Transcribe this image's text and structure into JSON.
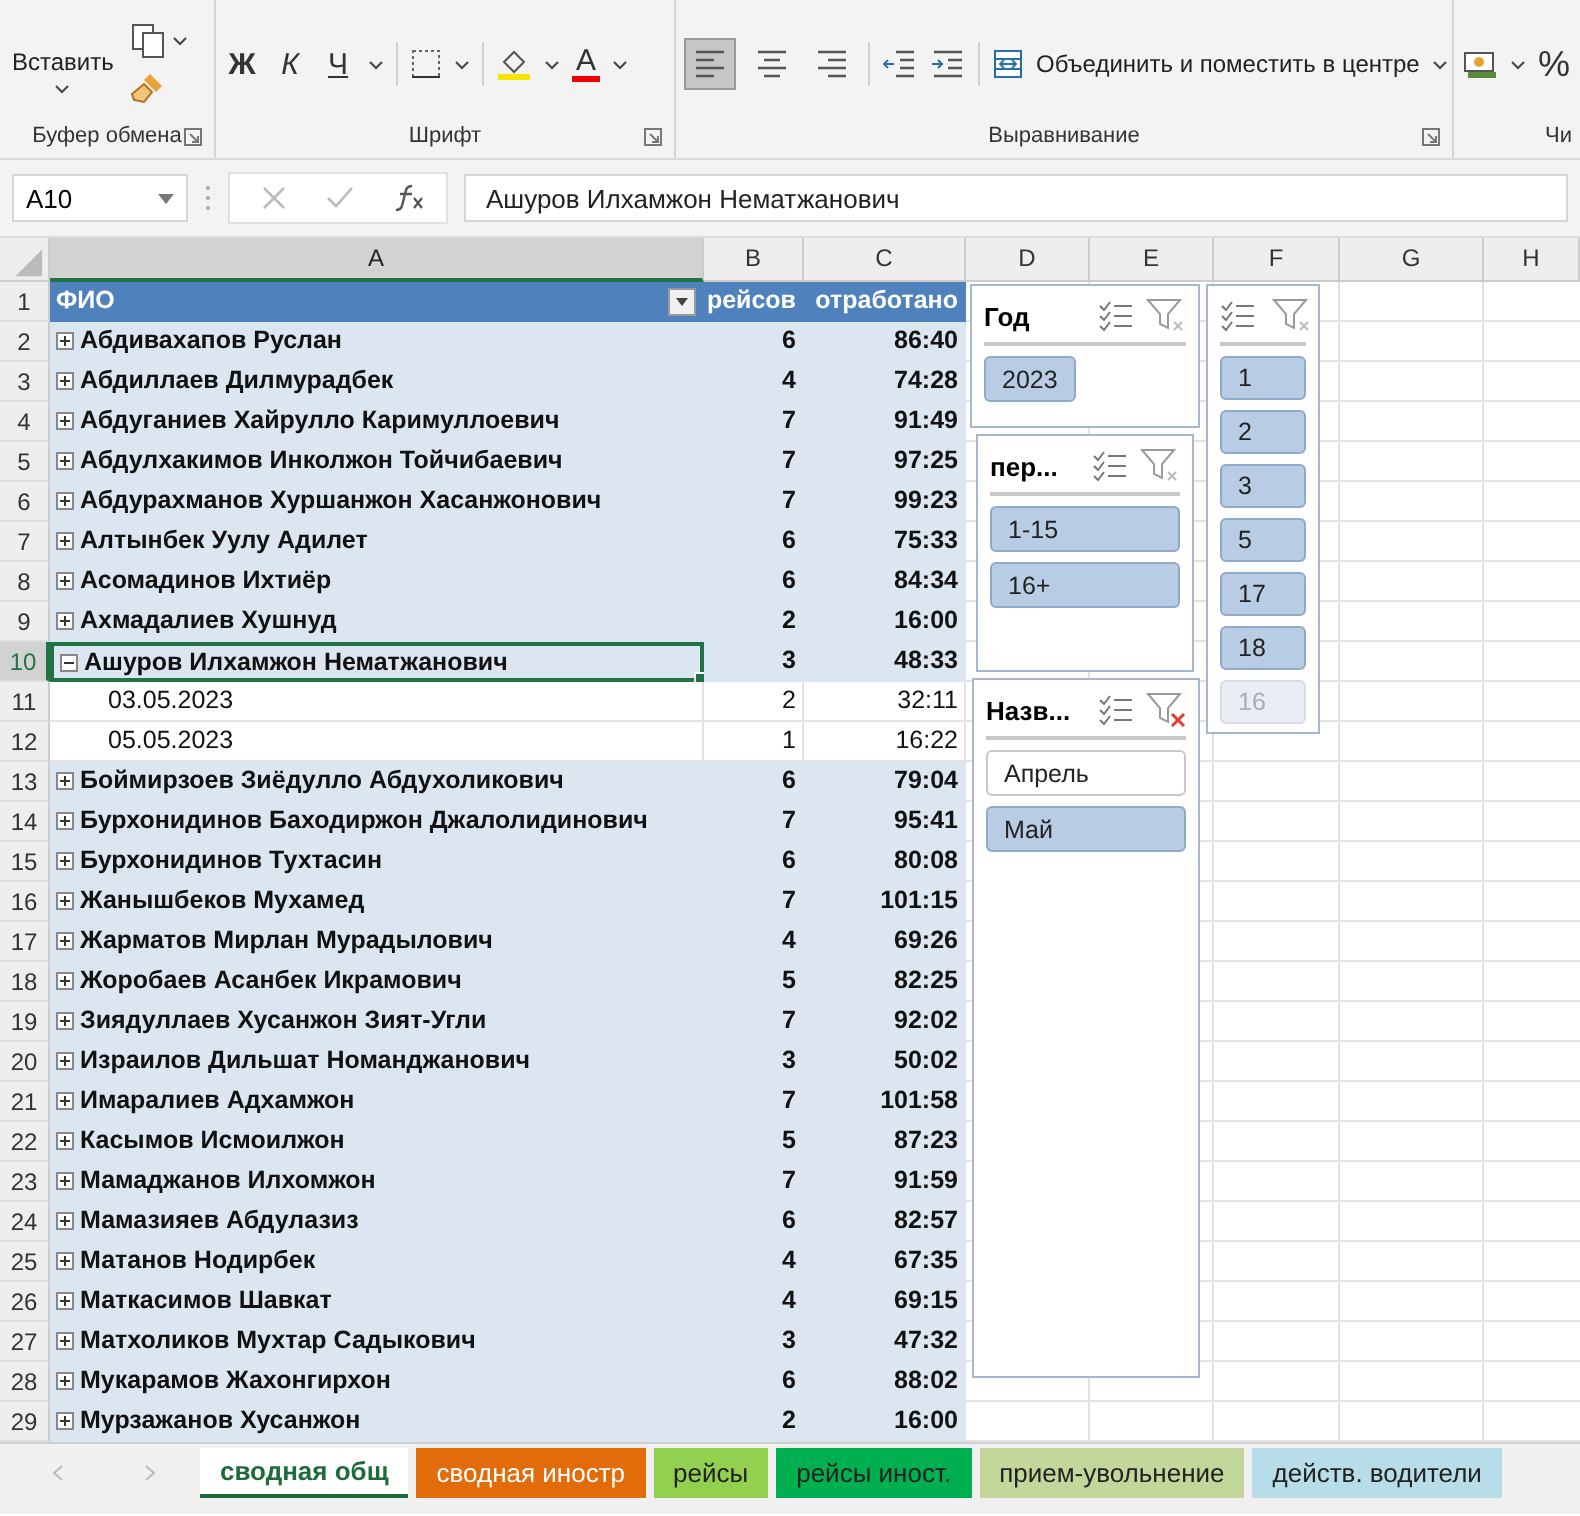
{
  "ribbon": {
    "paste_label": "Вставить",
    "font_buttons": [
      "Ж",
      "К",
      "Ч"
    ],
    "font_color_glyph": "A",
    "align_buttons": [
      {
        "selected": true
      },
      {
        "selected": false
      },
      {
        "selected": false
      }
    ],
    "merge_label": "Объединить и поместить в центре",
    "percent": "%",
    "groups": [
      {
        "label": "Буфер обмена"
      },
      {
        "label": "Шрифт"
      },
      {
        "label": "Выравнивание"
      },
      {
        "label": "Чи"
      }
    ]
  },
  "name_box": "A10",
  "formula": "Ашуров Илхамжон Нематжанович",
  "columns": [
    {
      "label": "A",
      "selected": true
    },
    {
      "label": "B",
      "selected": false
    },
    {
      "label": "C",
      "selected": false
    },
    {
      "label": "D",
      "selected": false
    },
    {
      "label": "E",
      "selected": false
    },
    {
      "label": "F",
      "selected": false
    },
    {
      "label": "G",
      "selected": false
    },
    {
      "label": "H",
      "selected": false
    }
  ],
  "table": {
    "header_row": "1",
    "headers": [
      "ФИО",
      "рейсов",
      "отработано"
    ],
    "rows": [
      {
        "row": "2",
        "kind": "group",
        "expanded": false,
        "selected": false,
        "name": "Абдивахапов Руслан",
        "trips": "6",
        "hours": "86:40"
      },
      {
        "row": "3",
        "kind": "group",
        "expanded": false,
        "selected": false,
        "name": "Абдиллаев Дилмурадбек",
        "trips": "4",
        "hours": "74:28"
      },
      {
        "row": "4",
        "kind": "group",
        "expanded": false,
        "selected": false,
        "name": "Абдуганиев Хайрулло Каримуллоевич",
        "trips": "7",
        "hours": "91:49"
      },
      {
        "row": "5",
        "kind": "group",
        "expanded": false,
        "selected": false,
        "name": "Абдулхакимов Инколжон Тойчибаевич",
        "trips": "7",
        "hours": "97:25"
      },
      {
        "row": "6",
        "kind": "group",
        "expanded": false,
        "selected": false,
        "name": "Абдурахманов Хуршанжон Хасанжонович",
        "trips": "7",
        "hours": "99:23"
      },
      {
        "row": "7",
        "kind": "group",
        "expanded": false,
        "selected": false,
        "name": "Алтынбек Уулу Адилет",
        "trips": "6",
        "hours": "75:33"
      },
      {
        "row": "8",
        "kind": "group",
        "expanded": false,
        "selected": false,
        "name": "Асомадинов Ихтиёр",
        "trips": "6",
        "hours": "84:34"
      },
      {
        "row": "9",
        "kind": "group",
        "expanded": false,
        "selected": false,
        "name": "Ахмадалиев Хушнуд",
        "trips": "2",
        "hours": "16:00"
      },
      {
        "row": "10",
        "kind": "group",
        "expanded": true,
        "selected": true,
        "name": "Ашуров Илхамжон Нематжанович",
        "trips": "3",
        "hours": "48:33"
      },
      {
        "row": "11",
        "kind": "detail",
        "selected": false,
        "name": "03.05.2023",
        "trips": "2",
        "hours": "32:11"
      },
      {
        "row": "12",
        "kind": "detail",
        "selected": false,
        "name": "05.05.2023",
        "trips": "1",
        "hours": "16:22"
      },
      {
        "row": "13",
        "kind": "group",
        "expanded": false,
        "selected": false,
        "name": "Боймирзоев Зиёдулло Абдухоликович",
        "trips": "6",
        "hours": "79:04"
      },
      {
        "row": "14",
        "kind": "group",
        "expanded": false,
        "selected": false,
        "name": "Бурхонидинов Баходиржон Джалолидинович",
        "trips": "7",
        "hours": "95:41"
      },
      {
        "row": "15",
        "kind": "group",
        "expanded": false,
        "selected": false,
        "name": "Бурхонидинов Тухтасин",
        "trips": "6",
        "hours": "80:08"
      },
      {
        "row": "16",
        "kind": "group",
        "expanded": false,
        "selected": false,
        "name": "Жанышбеков Мухамед",
        "trips": "7",
        "hours": "101:15"
      },
      {
        "row": "17",
        "kind": "group",
        "expanded": false,
        "selected": false,
        "name": "Жарматов Мирлан Мурадылович",
        "trips": "4",
        "hours": "69:26"
      },
      {
        "row": "18",
        "kind": "group",
        "expanded": false,
        "selected": false,
        "name": "Жоробаев Асанбек Икрамович",
        "trips": "5",
        "hours": "82:25"
      },
      {
        "row": "19",
        "kind": "group",
        "expanded": false,
        "selected": false,
        "name": "Зиядуллаев Хусанжон Зият-Угли",
        "trips": "7",
        "hours": "92:02"
      },
      {
        "row": "20",
        "kind": "group",
        "expanded": false,
        "selected": false,
        "name": "Израилов Дильшат Номанджанович",
        "trips": "3",
        "hours": "50:02"
      },
      {
        "row": "21",
        "kind": "group",
        "expanded": false,
        "selected": false,
        "name": "Имаралиев Адхамжон",
        "trips": "7",
        "hours": "101:58"
      },
      {
        "row": "22",
        "kind": "group",
        "expanded": false,
        "selected": false,
        "name": "Касымов Исмоилжон",
        "trips": "5",
        "hours": "87:23"
      },
      {
        "row": "23",
        "kind": "group",
        "expanded": false,
        "selected": false,
        "name": "Мамаджанов Илхомжон",
        "trips": "7",
        "hours": "91:59"
      },
      {
        "row": "24",
        "kind": "group",
        "expanded": false,
        "selected": false,
        "name": "Мамазияев Абдулазиз",
        "trips": "6",
        "hours": "82:57"
      },
      {
        "row": "25",
        "kind": "group",
        "expanded": false,
        "selected": false,
        "name": "Матанов Нодирбек",
        "trips": "4",
        "hours": "67:35"
      },
      {
        "row": "26",
        "kind": "group",
        "expanded": false,
        "selected": false,
        "name": "Маткасимов Шавкат",
        "trips": "4",
        "hours": "69:15"
      },
      {
        "row": "27",
        "kind": "group",
        "expanded": false,
        "selected": false,
        "name": "Матхоликов Мухтар Садыкович",
        "trips": "3",
        "hours": "47:32"
      },
      {
        "row": "28",
        "kind": "group",
        "expanded": false,
        "selected": false,
        "name": "Мукарамов Жахонгирхон",
        "trips": "6",
        "hours": "88:02"
      },
      {
        "row": "29",
        "kind": "group",
        "expanded": false,
        "selected": false,
        "name": "Мурзажанов Хусанжон",
        "trips": "2",
        "hours": "16:00"
      }
    ]
  },
  "slicers": [
    {
      "title": "Год",
      "filtered": false,
      "items": [
        {
          "label": "2023",
          "selected": true,
          "available": true
        }
      ]
    },
    {
      "title": "пер...",
      "filtered": false,
      "items": [
        {
          "label": "1-15",
          "selected": true,
          "available": true
        },
        {
          "label": "16+",
          "selected": true,
          "available": true
        }
      ]
    },
    {
      "title": "Назв...",
      "filtered": true,
      "items": [
        {
          "label": "Апрель",
          "selected": false,
          "available": true
        },
        {
          "label": "Май",
          "selected": true,
          "available": true
        }
      ]
    },
    {
      "filtered": false,
      "items": [
        {
          "label": "1",
          "selected": true,
          "available": true
        },
        {
          "label": "2",
          "selected": true,
          "available": true
        },
        {
          "label": "3",
          "selected": true,
          "available": true
        },
        {
          "label": "5",
          "selected": true,
          "available": true
        },
        {
          "label": "17",
          "selected": true,
          "available": true
        },
        {
          "label": "18",
          "selected": true,
          "available": true
        },
        {
          "label": "16",
          "selected": false,
          "available": false
        }
      ]
    }
  ],
  "sheet_tabs": [
    {
      "label": "сводная общ",
      "selected": true,
      "color": "#ffffff"
    },
    {
      "label": "сводная иностр",
      "selected": false,
      "color": "#e26b0a"
    },
    {
      "label": "рейсы",
      "selected": false,
      "color": "#92d050"
    },
    {
      "label": "рейсы иност.",
      "selected": false,
      "color": "#00b050"
    },
    {
      "label": "прием-увольнение",
      "selected": false,
      "color": "#c4d79b"
    },
    {
      "label": "действ. водители",
      "selected": false,
      "color": "#b7dee8"
    }
  ]
}
